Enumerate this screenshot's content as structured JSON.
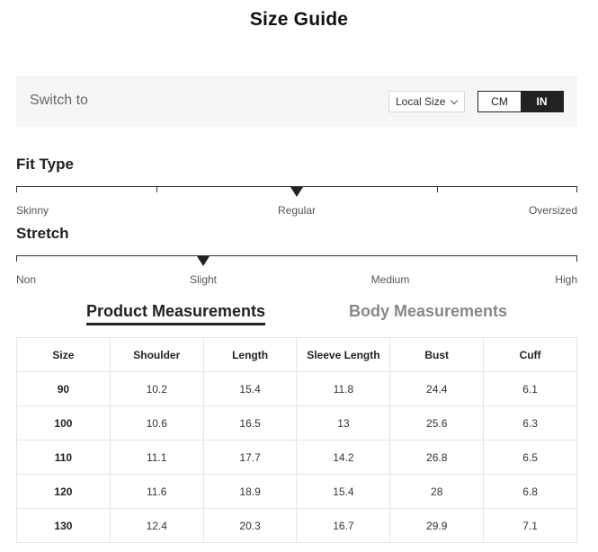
{
  "title": "Size Guide",
  "switch_bar": {
    "label": "Switch to",
    "size_select": {
      "selected": "Local Size"
    },
    "units": {
      "cm": "CM",
      "in": "IN",
      "active": "IN"
    }
  },
  "fit_type": {
    "title": "Fit Type",
    "labels": [
      "Skinny",
      "Regular",
      "Oversized"
    ],
    "selected": "Regular"
  },
  "stretch": {
    "title": "Stretch",
    "labels": [
      "Non",
      "Slight",
      "Medium",
      "High"
    ],
    "selected": "Slight"
  },
  "tabs": [
    {
      "label": "Product Measurements",
      "active": true
    },
    {
      "label": "Body Measurements",
      "active": false
    }
  ],
  "table": {
    "headers": [
      "Size",
      "Shoulder",
      "Length",
      "Sleeve Length",
      "Bust",
      "Cuff"
    ],
    "rows": [
      [
        "90",
        "10.2",
        "15.4",
        "11.8",
        "24.4",
        "6.1"
      ],
      [
        "100",
        "10.6",
        "16.5",
        "13",
        "25.6",
        "6.3"
      ],
      [
        "110",
        "11.1",
        "17.7",
        "14.2",
        "26.8",
        "6.5"
      ],
      [
        "120",
        "11.6",
        "18.9",
        "15.4",
        "28",
        "6.8"
      ],
      [
        "130",
        "12.4",
        "20.3",
        "16.7",
        "29.9",
        "7.1"
      ]
    ]
  }
}
